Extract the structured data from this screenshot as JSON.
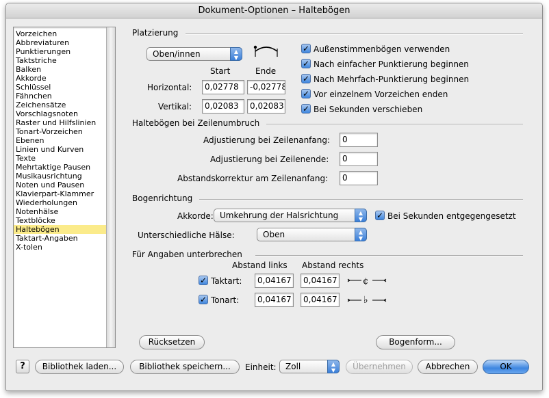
{
  "window": {
    "title": "Dokument-Optionen – Haltebögen"
  },
  "sidebar": {
    "items": [
      "Vorzeichen",
      "Abbreviaturen",
      "Punktierungen",
      "Taktstriche",
      "Balken",
      "Akkorde",
      "Schlüssel",
      "Fähnchen",
      "Zeichensätze",
      "Vorschlagsnoten",
      "Raster und Hilfslinien",
      "Tonart-Vorzeichen",
      "Ebenen",
      "Linien und Kurven",
      "Texte",
      "Mehrtaktige Pausen",
      "Musikausrichtung",
      "Noten und Pausen",
      "Klavierpart-Klammer",
      "Wiederholungen",
      "Notenhälse",
      "Textblöcke",
      "Haltebögen",
      "Taktart-Angaben",
      "X-tolen"
    ],
    "selected_index": 22
  },
  "platzierung": {
    "title": "Platzierung",
    "position_select": "Oben/innen",
    "start_label": "Start",
    "end_label": "Ende",
    "horizontal_label": "Horizontal:",
    "horizontal_start": "0,02778",
    "horizontal_end": "-0,02778",
    "vertical_label": "Vertikal:",
    "vertical_start": "0,02083",
    "vertical_end": "0,02083",
    "checkboxes": [
      {
        "label": "Außenstimmenbögen verwenden",
        "checked": true
      },
      {
        "label": "Nach einfacher Punktierung beginnen",
        "checked": true
      },
      {
        "label": "Nach Mehrfach-Punktierung beginnen",
        "checked": true
      },
      {
        "label": "Vor einzelnem Vorzeichen enden",
        "checked": true
      },
      {
        "label": "Bei Sekunden verschieben",
        "checked": true
      }
    ]
  },
  "umbruch": {
    "title": "Haltebögen bei Zeilenumbruch",
    "rows": [
      {
        "label": "Adjustierung bei Zeilenanfang:",
        "value": "0"
      },
      {
        "label": "Adjustierung bei Zeilenende:",
        "value": "0"
      },
      {
        "label": "Abstandskorrektur am Zeilenanfang:",
        "value": "0"
      }
    ]
  },
  "bogenrichtung": {
    "title": "Bogenrichtung",
    "akkorde_label": "Akkorde:",
    "akkorde_value": "Umkehrung der Halsrichtung",
    "sekunden_label": "Bei Sekunden entgegengesetzt",
    "sekunden_checked": true,
    "haelse_label": "Unterschiedliche Hälse:",
    "haelse_value": "Oben"
  },
  "unterbrechen": {
    "title": "Für Angaben unterbrechen",
    "abstand_links": "Abstand links",
    "abstand_rechts": "Abstand rechts",
    "rows": [
      {
        "label": "Taktart:",
        "checked": true,
        "left": "0,04167",
        "right": "0,04167"
      },
      {
        "label": "Tonart:",
        "checked": true,
        "left": "0,04167",
        "right": "0,04167"
      }
    ]
  },
  "buttons": {
    "reset": "Rücksetzen",
    "bogenform": "Bogenform...",
    "help": "?",
    "load": "Bibliothek laden...",
    "save": "Bibliothek speichern...",
    "einheit_label": "Einheit:",
    "einheit_value": "Zoll",
    "apply": "Übernehmen",
    "cancel": "Abbrechen",
    "ok": "OK"
  },
  "checkmark": "✓"
}
